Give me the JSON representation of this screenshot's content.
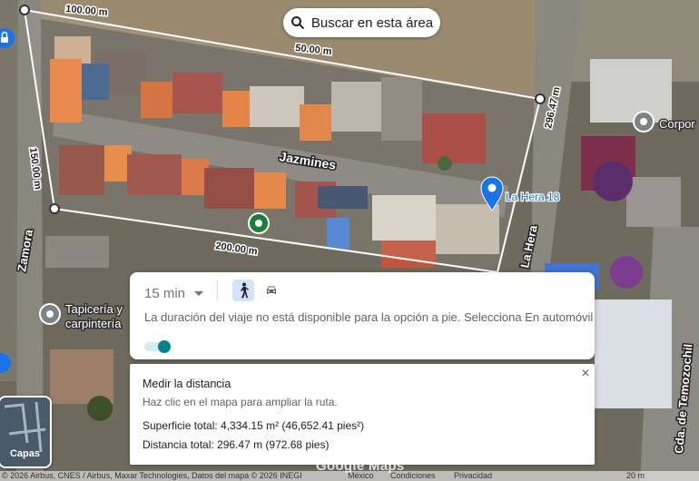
{
  "search_area_button": "Buscar en esta área",
  "streets": {
    "jazmines": "Jazmines",
    "zamora": "Zamora",
    "la_hera": "La Hera",
    "temozochil_1": "Cda. de Temozochil",
    "temozochil_2": "Cda. de Temoz"
  },
  "distance_labels": {
    "top": "100.00 m",
    "top_right": "50.00 m",
    "right": "296.47 m",
    "left": "150.00 m",
    "bottom": "200.00 m"
  },
  "places": {
    "marker_label": "La Hera 18",
    "corpor": "Corpor",
    "tapiceria_1": "Tapicería y",
    "tapiceria_2": "carpintería"
  },
  "travel_card": {
    "time_option": "15 min",
    "message": "La duración del viaje no está disponible para la opción a pie. Selecciona En automóvil"
  },
  "measure_card": {
    "title": "Medir la distancia",
    "hint": "Haz clic en el mapa para ampliar la ruta.",
    "area": "Superficie total: 4,334.15 m² (46,652.41 pies²)",
    "distance": "Distancia total: 296.47 m (972.68 pies)",
    "close": "×"
  },
  "layers_button": "Capas",
  "attribution": {
    "copyright": "© 2026 Airbus, CNES / Airbus, Maxar Technologies, Datos del mapa © 2026 INEGI",
    "mexico": "México",
    "conditions": "Condiciones",
    "privacy": "Privacidad",
    "scale": "20 m",
    "watermark": "Google Maps"
  },
  "colors": {
    "accent_teal": "#00838f",
    "marker_blue": "#1a73e8",
    "marker_green": "#188038",
    "walk_mode_bg": "#d2e3fc"
  }
}
